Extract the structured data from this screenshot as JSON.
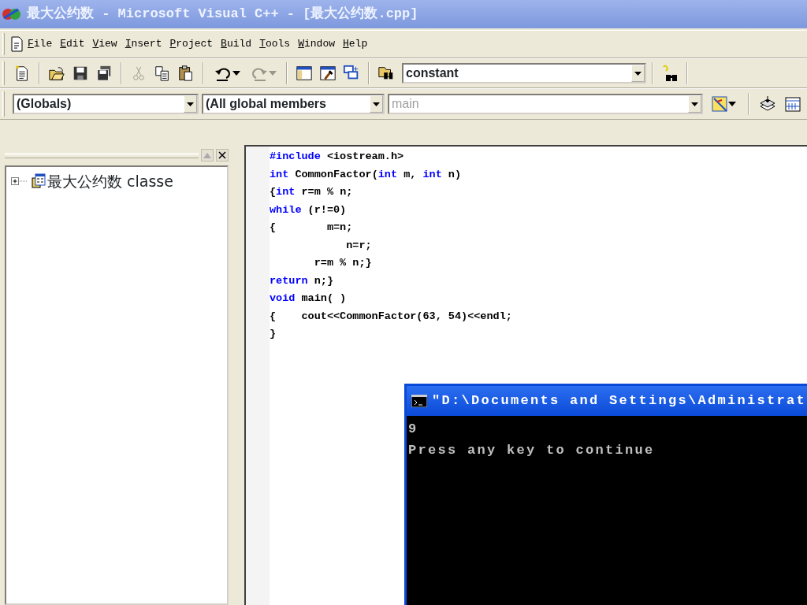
{
  "window": {
    "title": "最大公约数 - Microsoft Visual C++ - [最大公约数.cpp]"
  },
  "menu_bar": {
    "items": [
      "File",
      "Edit",
      "View",
      "Insert",
      "Project",
      "Build",
      "Tools",
      "Window",
      "Help"
    ]
  },
  "standard_toolbar": {
    "buttons": [
      {
        "disabled": false,
        "dropdown": false
      },
      {
        "disabled": false,
        "dropdown": false
      },
      {
        "disabled": false,
        "dropdown": false
      },
      {
        "disabled": false,
        "dropdown": false
      },
      {
        "disabled": true,
        "dropdown": false
      },
      {
        "disabled": false,
        "dropdown": false
      },
      {
        "disabled": false,
        "dropdown": false
      },
      {
        "disabled": false,
        "dropdown": true
      },
      {
        "disabled": true,
        "dropdown": true
      },
      {
        "disabled": false,
        "dropdown": false
      },
      {
        "disabled": false,
        "dropdown": false
      },
      {
        "disabled": false,
        "dropdown": false
      },
      {
        "disabled": false,
        "dropdown": false
      }
    ],
    "find_combo": {
      "value": "constant"
    }
  },
  "wizard_bar": {
    "class_combo": {
      "value": "(Globals)",
      "disabled": false
    },
    "filter_combo": {
      "value": "(All global members",
      "disabled": false
    },
    "member_combo": {
      "value": "main",
      "disabled": true
    }
  },
  "workspace": {
    "tree": [
      {
        "label": "最大公约数 classe",
        "expanded": false
      }
    ]
  },
  "editor": {
    "lines": [
      [
        {
          "kind": "keyword",
          "text": "#include"
        },
        {
          "kind": "plain",
          "text": " <iostream.h>"
        }
      ],
      [
        {
          "kind": "keyword",
          "text": "int"
        },
        {
          "kind": "plain",
          "text": " CommonFactor("
        },
        {
          "kind": "keyword",
          "text": "int"
        },
        {
          "kind": "plain",
          "text": " m, "
        },
        {
          "kind": "keyword",
          "text": "int"
        },
        {
          "kind": "plain",
          "text": " n)"
        }
      ],
      [
        {
          "kind": "plain",
          "text": "{"
        },
        {
          "kind": "keyword",
          "text": "int"
        },
        {
          "kind": "plain",
          "text": " r=m % n;"
        }
      ],
      [
        {
          "kind": "keyword",
          "text": "while"
        },
        {
          "kind": "plain",
          "text": " (r!=0)"
        }
      ],
      [
        {
          "kind": "plain",
          "text": "{        m=n;"
        }
      ],
      [
        {
          "kind": "plain",
          "text": "            n=r;"
        }
      ],
      [
        {
          "kind": "plain",
          "text": "       r=m % n;}"
        }
      ],
      [
        {
          "kind": "keyword",
          "text": "return"
        },
        {
          "kind": "plain",
          "text": " n;}"
        }
      ],
      [
        {
          "kind": "keyword",
          "text": "void"
        },
        {
          "kind": "plain",
          "text": " main( )"
        }
      ],
      [
        {
          "kind": "plain",
          "text": "{    cout<<CommonFactor(63, 54)<<endl;"
        }
      ],
      [
        {
          "kind": "plain",
          "text": "}"
        }
      ]
    ]
  },
  "console": {
    "title": "\"D:\\Documents and Settings\\Administrat",
    "lines": [
      "9",
      "Press any key to continue"
    ]
  }
}
